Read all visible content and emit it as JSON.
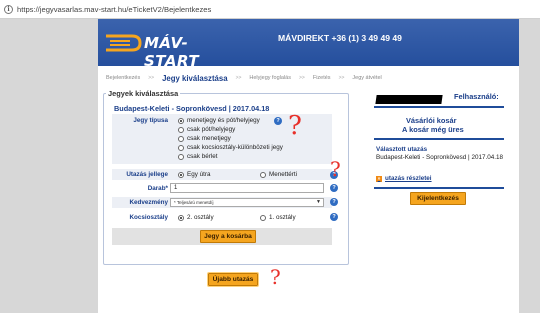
{
  "browser": {
    "url": "https://jegyvasarlas.mav-start.hu/eTicketV2/Bejelentkezes"
  },
  "header": {
    "logo_text": "MÁV-START",
    "hotline": "MÁVDIREKT +36 (1) 3 49 49 49"
  },
  "steps": {
    "items": [
      "Bejelentkezés",
      "Jegy kiválasztása",
      "Helyjegy foglalás",
      "Fizetés",
      "Jegy átvétel"
    ],
    "separator": ">>"
  },
  "form": {
    "legend": "Jegyek kiválasztása",
    "route": "Budapest-Keleti - Sopronkövesd | 2017.04.18",
    "ticket_type_label": "Jegy típusa",
    "ticket_types": [
      "menetjegy és pót/helyjegy",
      "csak pót/helyjegy",
      "csak menetjegy",
      "csak kocsiosztály-különbözeti jegy",
      "csak bérlet"
    ],
    "trip_label": "Utazás jellege",
    "trip_one_way": "Egy útra",
    "trip_return": "Menettérti",
    "count_label": "Darab*",
    "count_value": "1",
    "discount_label": "Kedvezmény",
    "discount_value": "* Teljesárú menetdíj",
    "class_label": "Kocsiosztály",
    "class_second": "2. osztály",
    "class_first": "1. osztály",
    "cart_button": "Jegy a kosárba",
    "help_symbol": "?"
  },
  "new_trip_button": "Újabb utazás",
  "sidebar": {
    "user_label": "Felhasználó:",
    "cart_title": "Vásárlói kosár",
    "cart_empty": "A kosár még üres",
    "selected_title": "Választott utazás",
    "selected_route": "Budapest-Keleti - Sopronkövesd | 2017.04.18",
    "details_link": "utazás részletei",
    "logout_button": "Kijelentkezés"
  },
  "annotations": {
    "mark": "?"
  },
  "colors": {
    "brand_blue": "#254f9d",
    "accent_orange": "#f5a51f",
    "annotation_red": "#e8302a"
  }
}
